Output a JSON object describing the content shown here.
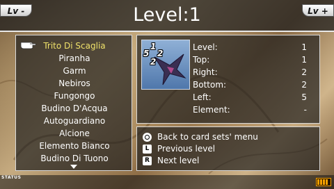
{
  "header": {
    "title": "Level:1",
    "lv_minus": "Lv -",
    "lv_plus": "Lv +"
  },
  "cards": [
    "Trito Di Scaglia",
    "Piranha",
    "Garm",
    "Nebiros",
    "Fungongo",
    "Budino D'Acqua",
    "Autoguardiano",
    "Alcione",
    "Elemento Bianco",
    "Budino Di Tuono"
  ],
  "selected_card_index": 0,
  "card_ranks": {
    "top": "1",
    "left": "5",
    "right": "2",
    "bottom": "2"
  },
  "stats": [
    {
      "label": "Level:",
      "value": "1"
    },
    {
      "label": "Top:",
      "value": "1"
    },
    {
      "label": "Right:",
      "value": "2"
    },
    {
      "label": "Bottom:",
      "value": "2"
    },
    {
      "label": "Left:",
      "value": "5"
    },
    {
      "label": "Element:",
      "value": "-"
    }
  ],
  "help": [
    {
      "button": "O",
      "icon": "circle-button-icon",
      "text": "Back to card sets' menu"
    },
    {
      "button": "L",
      "icon": "l-button-icon",
      "text": "Previous level"
    },
    {
      "button": "R",
      "icon": "r-button-icon",
      "text": "Next level"
    }
  ],
  "status": {
    "label": "STATUS"
  },
  "colors": {
    "selected_text": "#f0e26a",
    "panel_border": "#d8d8d8",
    "battery": "#f5a000"
  }
}
